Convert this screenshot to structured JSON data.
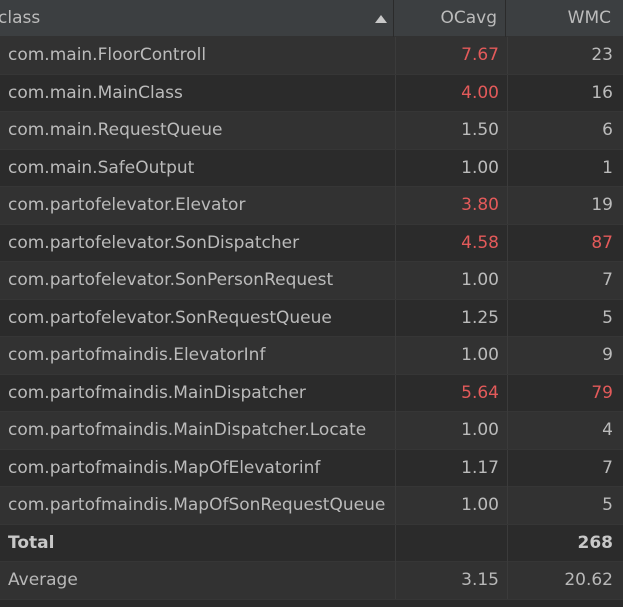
{
  "header": {
    "class_label": "class",
    "ocavg_label": "OCavg",
    "wmc_label": "WMC",
    "sort_icon": "sort-ascending-icon"
  },
  "colors": {
    "background": "#2b2b2b",
    "header_background": "#3c3f41",
    "text": "#bbbbbb",
    "warning_red": "#e35a5a"
  },
  "rows": [
    {
      "name": "com.main.FloorControll",
      "ocavg": "7.67",
      "wmc": "23",
      "ocavg_red": true,
      "wmc_red": false
    },
    {
      "name": "com.main.MainClass",
      "ocavg": "4.00",
      "wmc": "16",
      "ocavg_red": true,
      "wmc_red": false
    },
    {
      "name": "com.main.RequestQueue",
      "ocavg": "1.50",
      "wmc": "6",
      "ocavg_red": false,
      "wmc_red": false
    },
    {
      "name": "com.main.SafeOutput",
      "ocavg": "1.00",
      "wmc": "1",
      "ocavg_red": false,
      "wmc_red": false
    },
    {
      "name": "com.partofelevator.Elevator",
      "ocavg": "3.80",
      "wmc": "19",
      "ocavg_red": true,
      "wmc_red": false
    },
    {
      "name": "com.partofelevator.SonDispatcher",
      "ocavg": "4.58",
      "wmc": "87",
      "ocavg_red": true,
      "wmc_red": true
    },
    {
      "name": "com.partofelevator.SonPersonRequest",
      "ocavg": "1.00",
      "wmc": "7",
      "ocavg_red": false,
      "wmc_red": false
    },
    {
      "name": "com.partofelevator.SonRequestQueue",
      "ocavg": "1.25",
      "wmc": "5",
      "ocavg_red": false,
      "wmc_red": false
    },
    {
      "name": "com.partofmaindis.ElevatorInf",
      "ocavg": "1.00",
      "wmc": "9",
      "ocavg_red": false,
      "wmc_red": false
    },
    {
      "name": "com.partofmaindis.MainDispatcher",
      "ocavg": "5.64",
      "wmc": "79",
      "ocavg_red": true,
      "wmc_red": true
    },
    {
      "name": "com.partofmaindis.MainDispatcher.Locate",
      "ocavg": "1.00",
      "wmc": "4",
      "ocavg_red": false,
      "wmc_red": false
    },
    {
      "name": "com.partofmaindis.MapOfElevatorinf",
      "ocavg": "1.17",
      "wmc": "7",
      "ocavg_red": false,
      "wmc_red": false
    },
    {
      "name": "com.partofmaindis.MapOfSonRequestQueue",
      "ocavg": "1.00",
      "wmc": "5",
      "ocavg_red": false,
      "wmc_red": false
    }
  ],
  "total": {
    "label": "Total",
    "ocavg": "",
    "wmc": "268"
  },
  "average": {
    "label": "Average",
    "ocavg": "3.15",
    "wmc": "20.62"
  }
}
